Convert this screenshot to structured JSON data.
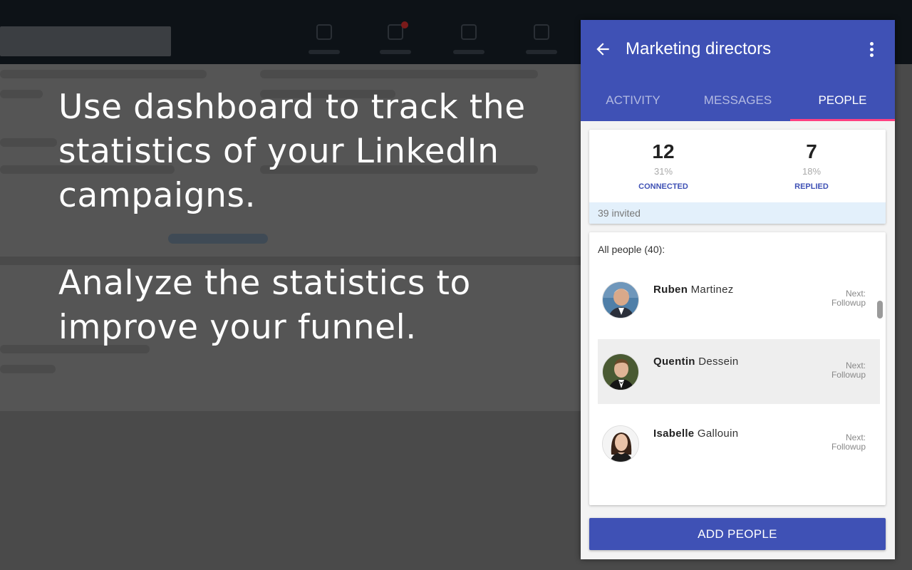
{
  "promo": {
    "line1": "Use dashboard to track the statistics of your LinkedIn campaigns.",
    "line2": "Analyze the statistics to improve your funnel."
  },
  "panel": {
    "title": "Marketing directors",
    "back_icon": "arrow-left-icon",
    "menu_icon": "more-vertical-icon",
    "tabs": [
      {
        "label": "ACTIVITY",
        "active": false
      },
      {
        "label": "MESSAGES",
        "active": false
      },
      {
        "label": "PEOPLE",
        "active": true
      }
    ],
    "stats": {
      "connected": {
        "count": "12",
        "percent": "31%",
        "label": "CONNECTED"
      },
      "replied": {
        "count": "7",
        "percent": "18%",
        "label": "REPLIED"
      },
      "invited": "39 invited"
    },
    "people": {
      "header": "All people (40):",
      "items": [
        {
          "first": "Ruben",
          "last": "Martinez",
          "next_label": "Next:",
          "next_value": "Followup",
          "highlighted": false
        },
        {
          "first": "Quentin",
          "last": "Dessein",
          "next_label": "Next:",
          "next_value": "Followup",
          "highlighted": true
        },
        {
          "first": "Isabelle",
          "last": "Gallouin",
          "next_label": "Next:",
          "next_value": "Followup",
          "highlighted": false
        }
      ]
    },
    "add_button": "ADD PEOPLE"
  },
  "colors": {
    "primary": "#3f51b5",
    "accent": "#ff4081",
    "invited_bg": "#e3f0fb"
  }
}
